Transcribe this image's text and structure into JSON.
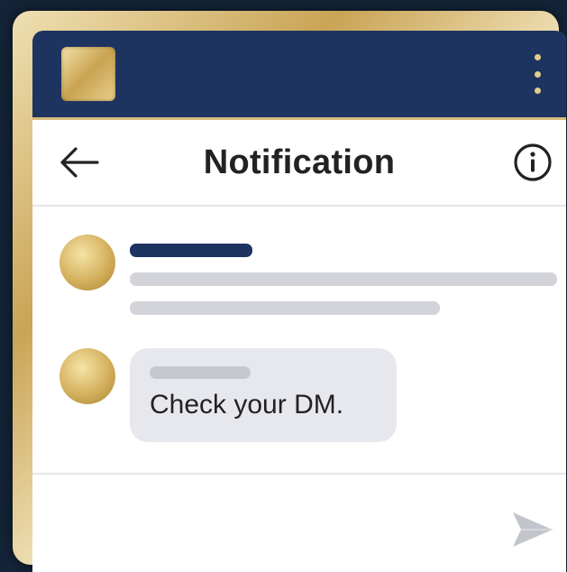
{
  "header": {
    "title": "Notification",
    "back_icon": "arrow-left-icon",
    "info_icon": "info-circle-icon"
  },
  "topbar": {
    "app_icon": "app-logo-icon",
    "menu_icon": "kebab-menu-icon"
  },
  "messages": [
    {
      "type": "placeholder-notification",
      "avatar_icon": "avatar-icon"
    },
    {
      "type": "bubble",
      "avatar_icon": "avatar-icon",
      "text": "Check your DM."
    }
  ],
  "composer": {
    "send_icon": "send-icon"
  },
  "colors": {
    "navy": "#1e3460",
    "gold": "#c9a455",
    "bubble": "#e7e8ed",
    "placeholder": "#d3d4da"
  }
}
